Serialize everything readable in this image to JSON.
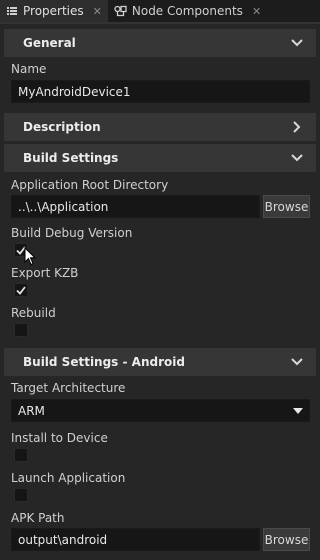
{
  "tabs": [
    {
      "label": "Properties",
      "icon": "list-icon",
      "active": true
    },
    {
      "label": "Node Components",
      "icon": "components-icon",
      "active": false
    }
  ],
  "sections": {
    "general": {
      "title": "General",
      "expanded": true
    },
    "description": {
      "title": "Description",
      "expanded": false
    },
    "build": {
      "title": "Build Settings",
      "expanded": true
    },
    "android": {
      "title": "Build Settings - Android",
      "expanded": true
    }
  },
  "fields": {
    "name": {
      "label": "Name",
      "value": "MyAndroidDevice1"
    },
    "app_root": {
      "label": "Application Root Directory",
      "value": "..\\..\\Application",
      "button": "Browse"
    },
    "debug": {
      "label": "Build Debug Version",
      "checked": true
    },
    "export_kzb": {
      "label": "Export KZB",
      "checked": true
    },
    "rebuild": {
      "label": "Rebuild",
      "checked": false
    },
    "target_arch": {
      "label": "Target Architecture",
      "value": "ARM"
    },
    "install": {
      "label": "Install to Device",
      "checked": false
    },
    "launch": {
      "label": "Launch Application",
      "checked": false
    },
    "apk_path": {
      "label": "APK Path",
      "value": "output\\android",
      "button": "Browse"
    }
  },
  "colors": {
    "background": "#262626",
    "header": "#363636",
    "input": "#161616",
    "text": "#d6d6d6"
  }
}
